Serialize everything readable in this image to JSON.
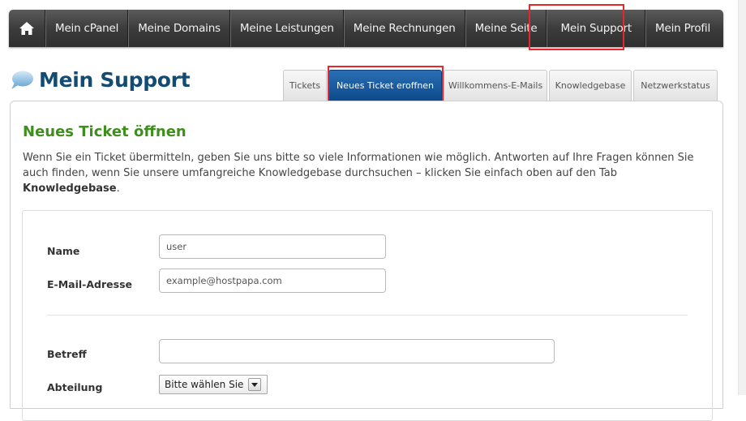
{
  "nav": {
    "home_icon": "home-icon",
    "items": [
      {
        "label": "Mein cPanel"
      },
      {
        "label": "Meine Domains"
      },
      {
        "label": "Meine Leistungen"
      },
      {
        "label": "Meine Rechnungen"
      },
      {
        "label": "Meine Seite"
      },
      {
        "label": "Mein Support"
      },
      {
        "label": "Mein Profil"
      }
    ]
  },
  "header": {
    "title": "Mein Support",
    "icon": "speech-bubble-icon"
  },
  "tabs": [
    {
      "label": "Tickets"
    },
    {
      "label": "Neues Ticket eroffnen"
    },
    {
      "label": "Willkommens-E-Mails"
    },
    {
      "label": "Knowledgebase"
    },
    {
      "label": "Netzwerkstatus"
    }
  ],
  "section": {
    "title": "Neues Ticket öffnen",
    "intro_text": "Wenn Sie ein Ticket übermitteln, geben Sie uns bitte so viele Informationen wie möglich. Antworten auf Ihre Fragen können Sie auch finden, wenn Sie unsere umfangreiche Knowledgebase durchsuchen – klicken Sie einfach oben auf den Tab ",
    "intro_bold": "Knowledgebase",
    "intro_end": "."
  },
  "form": {
    "name_label": "Name",
    "name_value": "user",
    "email_label": "E-Mail-Adresse",
    "email_value": "example@hostpapa.com",
    "subject_label": "Betreff",
    "subject_value": "",
    "department_label": "Abteilung",
    "department_value": "Bitte wählen Sie"
  },
  "colors": {
    "highlight": "#e8262b",
    "active_tab": "#0d4a8b",
    "title_blue": "#134b73",
    "section_green": "#3f8f1e"
  }
}
